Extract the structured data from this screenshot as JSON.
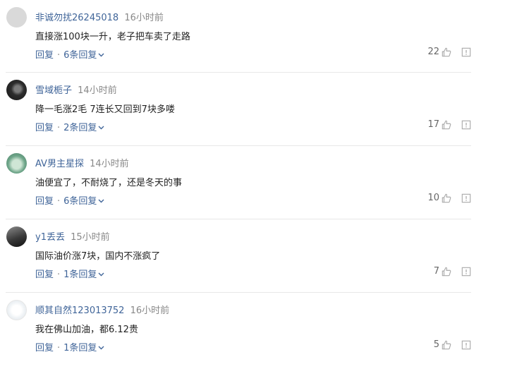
{
  "comments": [
    {
      "user": "非诚勿扰26245018",
      "time": "16小时前",
      "text": "直接涨100块一升，老子把车卖了走路",
      "reply_label": "回复",
      "reply_count_label": "6条回复",
      "likes": "22"
    },
    {
      "user": "雪域栀子",
      "time": "14小时前",
      "text": "降一毛涨2毛 7连长又回到7块多喽",
      "reply_label": "回复",
      "reply_count_label": "2条回复",
      "likes": "17"
    },
    {
      "user": "AV男主星探",
      "time": "14小时前",
      "text": "油便宜了，不耐烧了，还是冬天的事",
      "reply_label": "回复",
      "reply_count_label": "6条回复",
      "likes": "10"
    },
    {
      "user": "y1丢丢",
      "time": "15小时前",
      "text": "国际油价涨7块，国内不涨疯了",
      "reply_label": "回复",
      "reply_count_label": "1条回复",
      "likes": "7"
    },
    {
      "user": "顺其自然123013752",
      "time": "16小时前",
      "text": "我在佛山加油，都6.12贵",
      "reply_label": "回复",
      "reply_count_label": "1条回复",
      "likes": "5"
    }
  ],
  "separator": "·",
  "icons": {
    "like": "thumbs-up-icon",
    "report": "report-icon",
    "expand": "chevron-down-icon"
  },
  "colors": {
    "link": "#406599",
    "meta": "#888888",
    "icon": "#aaaaaa"
  }
}
